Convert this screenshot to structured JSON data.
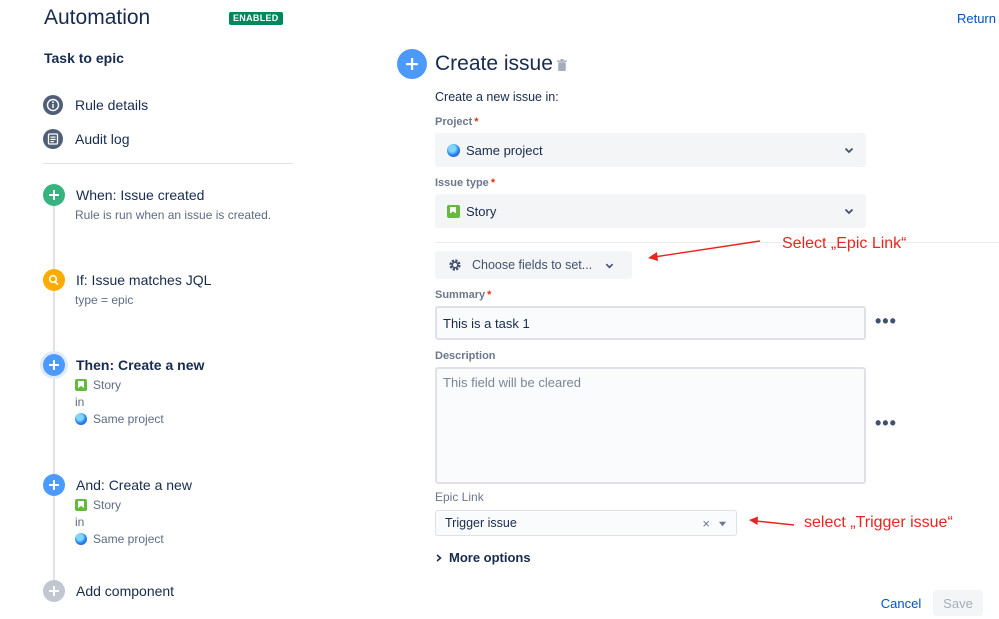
{
  "header": {
    "title": "Automation",
    "status_badge": "ENABLED",
    "return_label": "Return"
  },
  "sidebar": {
    "rule_name": "Task to epic",
    "nav": [
      {
        "label": "Rule details",
        "icon": "info-icon"
      },
      {
        "label": "Audit log",
        "icon": "list-icon"
      }
    ],
    "steps": [
      {
        "title": "When: Issue created",
        "sub": "Rule is run when an issue is created.",
        "color": "#36b37e",
        "icon": "plus-icon"
      },
      {
        "title": "If: Issue matches JQL",
        "sub": "type = epic",
        "color": "#ffab00",
        "icon": "search-icon"
      },
      {
        "title": "Then: Create a new",
        "issue_type": "Story",
        "in": "in",
        "project": "Same project",
        "color": "#4c9aff",
        "icon": "plus-icon",
        "selected": true
      },
      {
        "title": "And: Create a new",
        "issue_type": "Story",
        "in": "in",
        "project": "Same project",
        "color": "#4c9aff",
        "icon": "plus-icon"
      },
      {
        "title": "Add component",
        "color": "#c1c7d0",
        "icon": "plus-icon"
      }
    ]
  },
  "main": {
    "title": "Create issue",
    "subtitle": "Create a new issue in:",
    "project": {
      "label": "Project",
      "required": "*",
      "value": "Same project"
    },
    "issue_type": {
      "label": "Issue type",
      "required": "*",
      "value": "Story"
    },
    "choose_fields_label": "Choose fields to set...",
    "summary": {
      "label": "Summary",
      "required": "*",
      "value": "This is a task 1"
    },
    "description": {
      "label": "Description",
      "placeholder": "This field will be cleared"
    },
    "epic_link": {
      "label": "Epic Link",
      "value": "Trigger issue"
    },
    "more_options": "More options",
    "cancel_label": "Cancel",
    "save_label": "Save"
  },
  "annotations": {
    "epic": "Select „Epic Link“",
    "trigger": "select „Trigger issue“",
    "color": "#e8261f"
  }
}
